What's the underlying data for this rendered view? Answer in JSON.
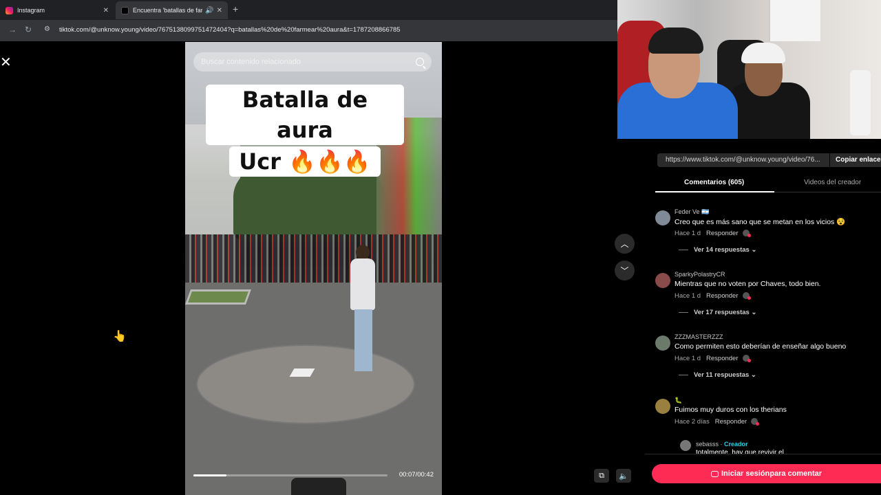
{
  "browser": {
    "tabs": [
      {
        "title": "Instagram",
        "icon": "instagram-icon"
      },
      {
        "title": "Encuentra 'batallas de farm…",
        "icon": "tiktok-icon"
      }
    ],
    "new_tab_label": "+",
    "url": "tiktok.com/@unknow.young/video/7675138099751472404?q=batallas%20de%20farmear%20aura&t=1787208866785"
  },
  "video": {
    "search_placeholder": "Buscar contenido relacionado",
    "caption_line1": "Batalla de aura",
    "caption_line2": "Ucr 🔥🔥🔥",
    "time": "00:07/00:42",
    "progress": 0.17
  },
  "panel": {
    "share_link": "https://www.tiktok.com/@unknow.young/video/76...",
    "copy_link_label": "Copiar enlace",
    "tabs": {
      "comments": "Comentarios (605)",
      "creator_videos": "Videos del creador"
    },
    "comments": [
      {
        "user": "Feder Ve 🇦🇷",
        "text": "Creo que es más sano que se metan en los vicios 😵",
        "time": "Hace 1 d",
        "reply": "Responder",
        "more": "Ver 14 respuestas ⌄"
      },
      {
        "user": "SparkyPolastryCR",
        "text": "Mientras que no voten por Chaves, todo bien.",
        "time": "Hace 1 d",
        "reply": "Responder",
        "more": "Ver 17 respuestas ⌄"
      },
      {
        "user": "ZZZMASTERZZZ",
        "text": "Como permiten esto deberían de enseñar algo bueno",
        "time": "Hace 1 d",
        "reply": "Responder",
        "more": "Ver 11 respuestas ⌄"
      },
      {
        "user": "🐛",
        "text": "Fuimos muy duros con los therians",
        "time": "Hace 2 días",
        "reply": "Responder",
        "more": ""
      }
    ],
    "sub_reply": {
      "user": "sebasss · ",
      "creator_label": "Creador",
      "text": "totalmente, hay que revivir el"
    },
    "login_label": "Iniciar sesiónpara comentar"
  },
  "colors": {
    "accent": "#fe2c55",
    "creator": "#20d5ec"
  }
}
